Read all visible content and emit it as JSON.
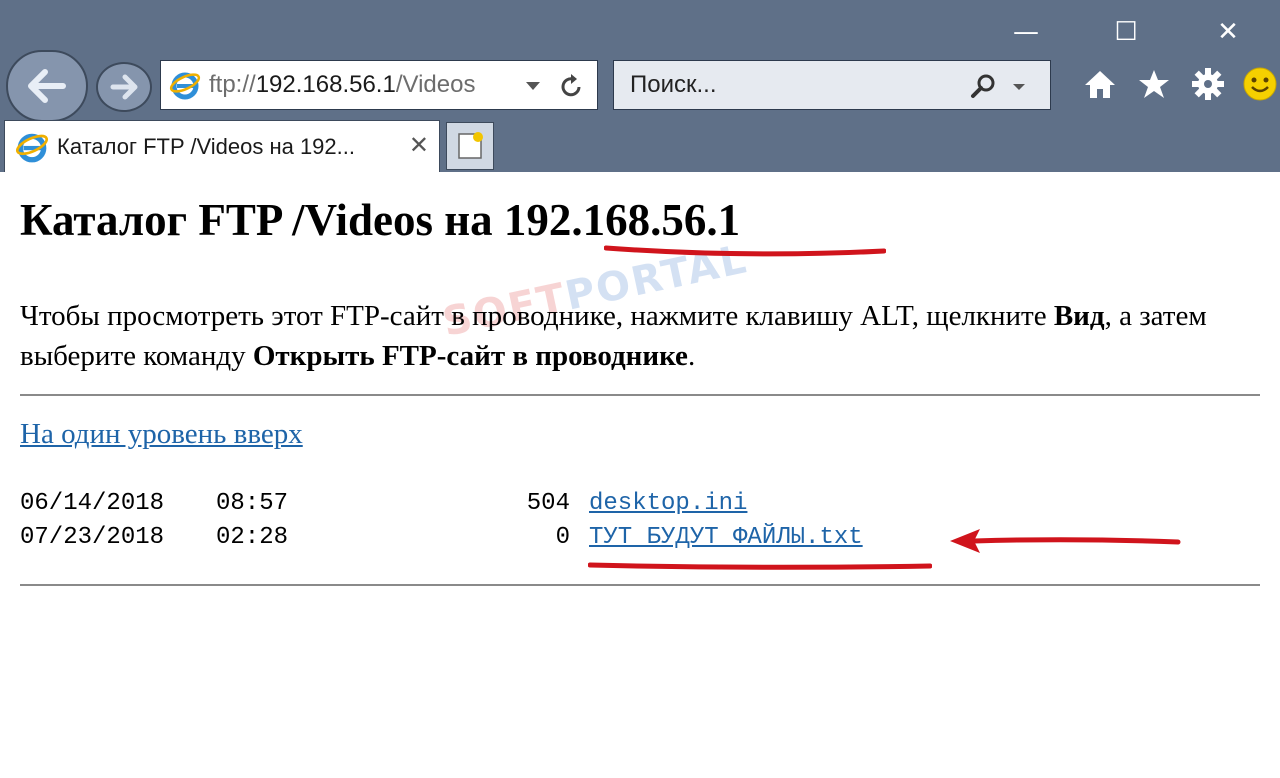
{
  "window": {
    "minimize": "—",
    "maximize": "☐",
    "close": "✕"
  },
  "address": {
    "scheme": "ftp://",
    "host": "192.168.56.1",
    "path": "/Videos"
  },
  "search": {
    "placeholder": "Поиск..."
  },
  "tab": {
    "title": "Каталог FTP /Videos на 192...",
    "close": "✕"
  },
  "page": {
    "heading_prefix": "Каталог FTP /Videos на ",
    "heading_host": "192.168.56.1",
    "instr_1": "Чтобы просмотреть этот FTP-сайт в проводнике, нажмите клавишу ALT, щелкните ",
    "instr_bold_1": "Вид",
    "instr_2": ", а затем выберите команду ",
    "instr_bold_2": "Открыть FTP-сайт в проводнике",
    "instr_3": ".",
    "up_link": "На один уровень вверх",
    "files": [
      {
        "date": "06/14/2018",
        "time": "08:57",
        "size": "504",
        "name": "desktop.ini"
      },
      {
        "date": "07/23/2018",
        "time": "02:28",
        "size": "0",
        "name": "ТУТ БУДУТ ФАЙЛЫ.txt"
      }
    ]
  },
  "watermark": {
    "part1": "SOFT",
    "part2": "PORTAL"
  },
  "annotation_color": "#d0141c",
  "link_color": "#1e64a8"
}
